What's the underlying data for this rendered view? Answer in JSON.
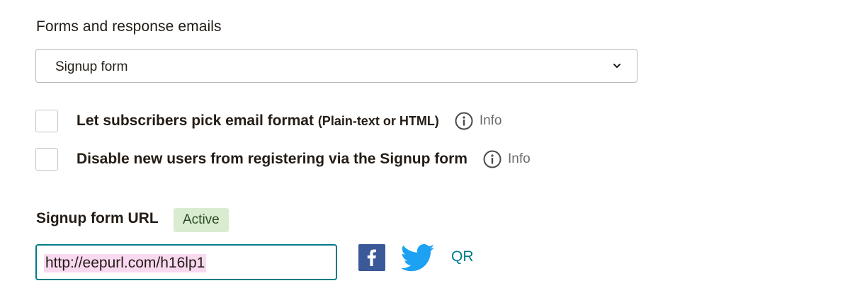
{
  "section": {
    "title": "Forms and response emails"
  },
  "form_select": {
    "selected": "Signup form",
    "icon": "chevron-down-icon"
  },
  "options": [
    {
      "label": "Let subscribers pick email format",
      "suffix": "(Plain-text or HTML)",
      "checked": false,
      "info_label": "Info"
    },
    {
      "label": "Disable new users from registering via the Signup form",
      "checked": false,
      "info_label": "Info"
    }
  ],
  "signup_url": {
    "title": "Signup form URL",
    "status": "Active",
    "status_color": "#d9ecd0",
    "value": "http://eepurl.com/h16lp1",
    "share": {
      "facebook_icon": "facebook-icon",
      "twitter_icon": "twitter-icon",
      "qr_label": "QR"
    }
  },
  "colors": {
    "accent": "#007c89",
    "facebook": "#3b5998",
    "twitter": "#1da1f2",
    "highlight": "#f8d9f0"
  }
}
